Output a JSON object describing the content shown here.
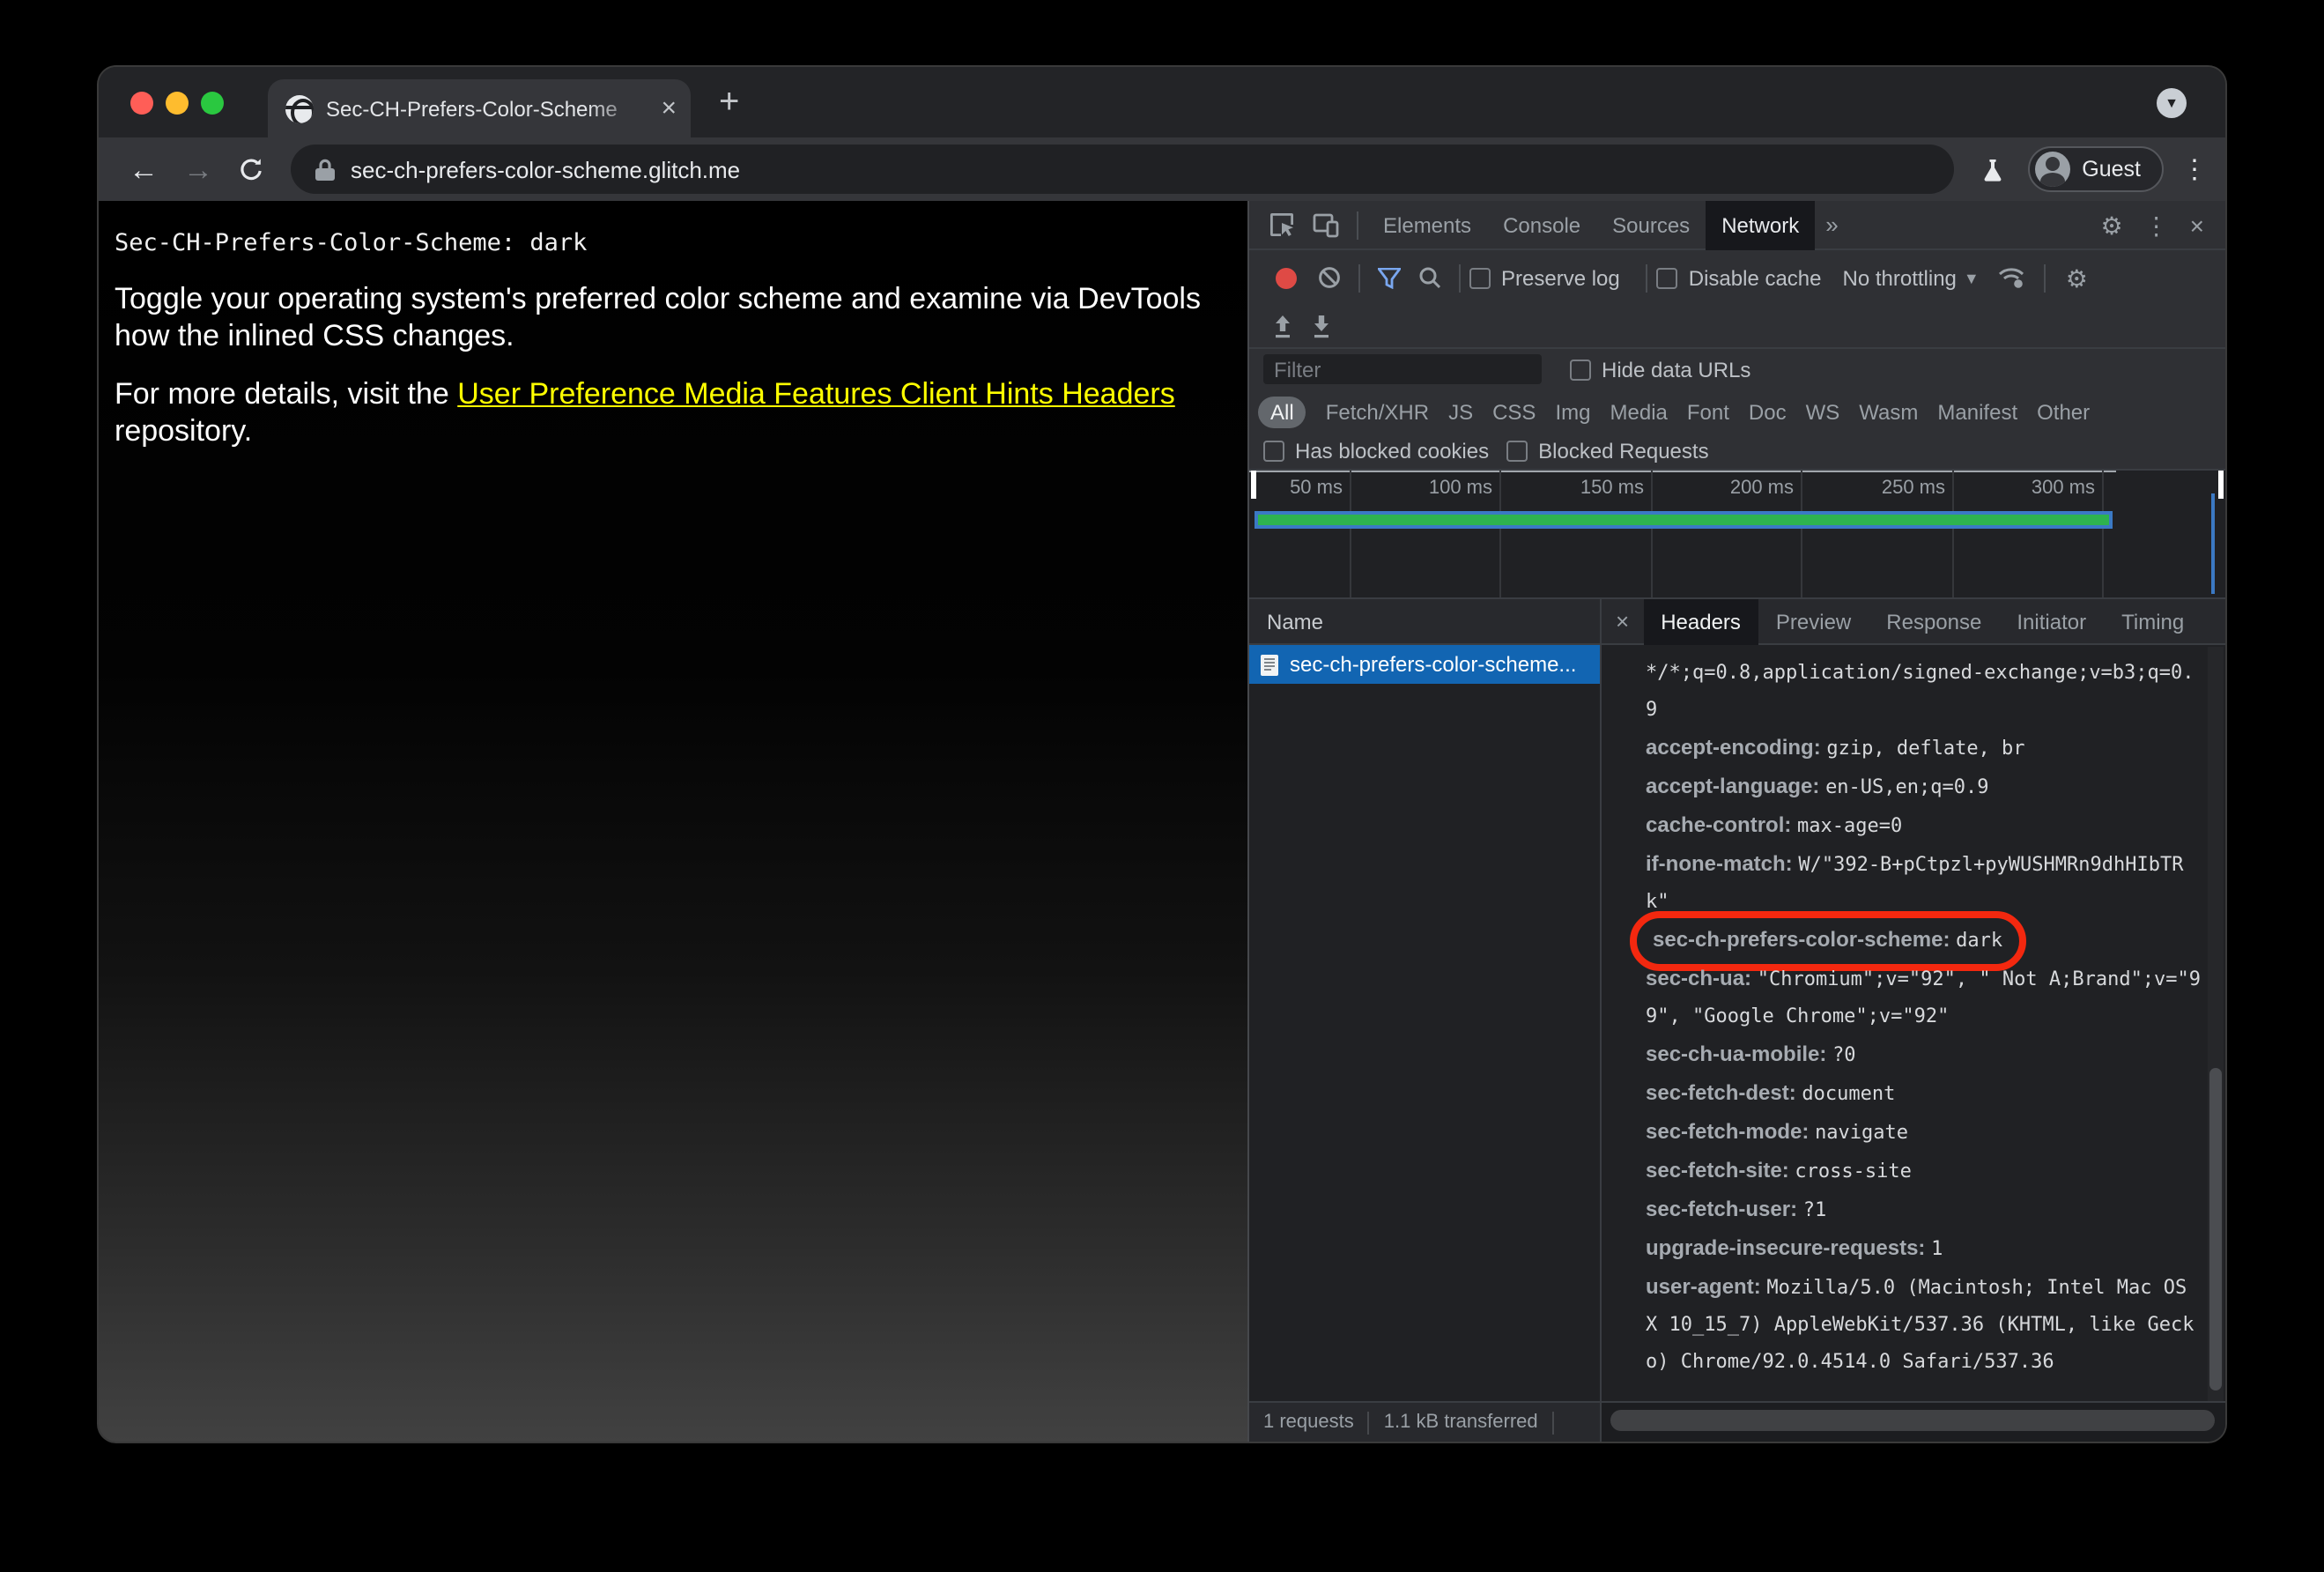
{
  "colors": {
    "annotation_red": "#f3280f",
    "selected_row": "#1265b2",
    "timeline_green": "#2eb34f",
    "timeline_blue": "#3b79c4",
    "record_red": "#df4a45",
    "link_yellow": "#ffff00"
  },
  "browser": {
    "tab_title": "Sec-CH-Prefers-Color-Scheme",
    "tab_close": "×",
    "new_tab": "+",
    "tab_search_caret": "▼",
    "back_arrow": "←",
    "forward_arrow": "→",
    "url": "sec-ch-prefers-color-scheme.glitch.me",
    "profile_name": "Guest",
    "overflow_dots": "⋮"
  },
  "page": {
    "code_line": "Sec-CH-Prefers-Color-Scheme: dark",
    "para1": "Toggle your operating system's preferred color scheme and examine via DevTools how the inlined CSS changes.",
    "para2_prefix": "For more details, visit the ",
    "link_text": "User Preference Media Features Client Hints Headers",
    "para2_suffix": " repository."
  },
  "devtools": {
    "tabs": [
      "Elements",
      "Console",
      "Sources",
      "Network"
    ],
    "more_tabs": "»",
    "gear": "⚙",
    "overflow_dots": "⋮",
    "close": "×",
    "toolbar": {
      "preserve_log": "Preserve log",
      "disable_cache": "Disable cache",
      "throttling": "No throttling",
      "dropdown_caret": "▼"
    },
    "filter": {
      "placeholder": "Filter",
      "hide_data_urls": "Hide data URLs",
      "chips": [
        "All",
        "Fetch/XHR",
        "JS",
        "CSS",
        "Img",
        "Media",
        "Font",
        "Doc",
        "WS",
        "Wasm",
        "Manifest",
        "Other"
      ],
      "has_blocked_cookies": "Has blocked cookies",
      "blocked_requests": "Blocked Requests"
    },
    "timeline_ticks": [
      "50 ms",
      "100 ms",
      "150 ms",
      "200 ms",
      "250 ms",
      "300 ms"
    ],
    "requests": {
      "column": "Name",
      "rows": [
        {
          "name": "sec-ch-prefers-color-scheme..."
        }
      ]
    },
    "panel_tabs": [
      "Headers",
      "Preview",
      "Response",
      "Initiator",
      "Timing"
    ],
    "panel_close": "×",
    "request_headers": [
      {
        "name": "",
        "value": "*/*;q=0.8,application/signed-exchange;v=b3;q=0.9"
      },
      {
        "name": "accept-encoding",
        "value": "gzip, deflate, br"
      },
      {
        "name": "accept-language",
        "value": "en-US,en;q=0.9"
      },
      {
        "name": "cache-control",
        "value": "max-age=0"
      },
      {
        "name": "if-none-match",
        "value": "W/\"392-B+pCtpzl+pyWUSHMRn9dhHIbTRk\""
      },
      {
        "name": "sec-ch-prefers-color-scheme",
        "value": "dark",
        "annotated": true
      },
      {
        "name": "sec-ch-ua",
        "value": "\"Chromium\";v=\"92\", \" Not A;Brand\";v=\"99\", \"Google Chrome\";v=\"92\""
      },
      {
        "name": "sec-ch-ua-mobile",
        "value": "?0"
      },
      {
        "name": "sec-fetch-dest",
        "value": "document"
      },
      {
        "name": "sec-fetch-mode",
        "value": "navigate"
      },
      {
        "name": "sec-fetch-site",
        "value": "cross-site"
      },
      {
        "name": "sec-fetch-user",
        "value": "?1"
      },
      {
        "name": "upgrade-insecure-requests",
        "value": "1"
      },
      {
        "name": "user-agent",
        "value": "Mozilla/5.0 (Macintosh; Intel Mac OS X 10_15_7) AppleWebKit/537.36 (KHTML, like Gecko) Chrome/92.0.4514.0 Safari/537.36"
      }
    ],
    "status": {
      "requests": "1 requests",
      "transferred": "1.1 kB transferred"
    }
  }
}
